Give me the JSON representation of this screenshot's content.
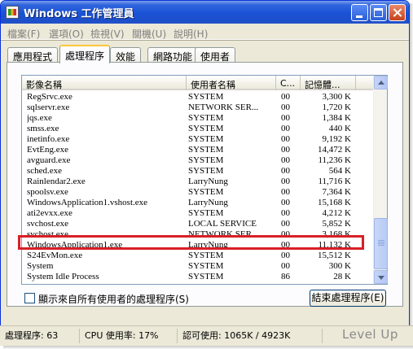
{
  "window": {
    "title": "Windows 工作管理員"
  },
  "menu": [
    "檔案(F)",
    "選項(O)",
    "檢視(V)",
    "關機(U)",
    "說明(H)"
  ],
  "tabs": [
    {
      "label": "應用程式",
      "active": false
    },
    {
      "label": "處理程序",
      "active": true
    },
    {
      "label": "效能",
      "active": false
    },
    {
      "label": "網路功能",
      "active": false
    },
    {
      "label": "使用者",
      "active": false
    }
  ],
  "table": {
    "columns": [
      "影像名稱",
      "使用者名稱",
      "C...",
      "記憶體..."
    ],
    "rows": [
      {
        "name": "RegSrvc.exe",
        "user": "SYSTEM",
        "cpu": "00",
        "mem": "3,300 K"
      },
      {
        "name": "sqlservr.exe",
        "user": "NETWORK SER...",
        "cpu": "00",
        "mem": "1,720 K"
      },
      {
        "name": "jqs.exe",
        "user": "SYSTEM",
        "cpu": "00",
        "mem": "1,384 K"
      },
      {
        "name": "smss.exe",
        "user": "SYSTEM",
        "cpu": "00",
        "mem": "440 K"
      },
      {
        "name": "inetinfo.exe",
        "user": "SYSTEM",
        "cpu": "00",
        "mem": "9,192 K"
      },
      {
        "name": "EvtEng.exe",
        "user": "SYSTEM",
        "cpu": "00",
        "mem": "14,472 K"
      },
      {
        "name": "avguard.exe",
        "user": "SYSTEM",
        "cpu": "00",
        "mem": "11,236 K"
      },
      {
        "name": "sched.exe",
        "user": "SYSTEM",
        "cpu": "00",
        "mem": "564 K"
      },
      {
        "name": "Rainlendar2.exe",
        "user": "LarryNung",
        "cpu": "00",
        "mem": "11,716 K"
      },
      {
        "name": "spoolsv.exe",
        "user": "SYSTEM",
        "cpu": "00",
        "mem": "7,364 K"
      },
      {
        "name": "WindowsApplication1.vshost.exe",
        "user": "LarryNung",
        "cpu": "00",
        "mem": "15,168 K"
      },
      {
        "name": "ati2evxx.exe",
        "user": "SYSTEM",
        "cpu": "00",
        "mem": "4,212 K"
      },
      {
        "name": "svchost.exe",
        "user": "LOCAL SERVICE",
        "cpu": "00",
        "mem": "5,852 K"
      },
      {
        "name": "svchost.exe",
        "user": "NETWORK SER...",
        "cpu": "00",
        "mem": "3,168 K"
      },
      {
        "name": "WindowsApplication1.exe",
        "user": "LarryNung",
        "cpu": "00",
        "mem": "11,132 K"
      },
      {
        "name": "S24EvMon.exe",
        "user": "SYSTEM",
        "cpu": "00",
        "mem": "15,512 K"
      },
      {
        "name": "System",
        "user": "SYSTEM",
        "cpu": "00",
        "mem": "300 K"
      },
      {
        "name": "System Idle Process",
        "user": "SYSTEM",
        "cpu": "86",
        "mem": "28 K"
      }
    ]
  },
  "show_all_users_label": "顯示來自所有使用者的處理程序(S)",
  "end_process_label": "結束處理程序(E)",
  "status": {
    "processes": "處理程序: 63",
    "cpu": "CPU 使用率: 17%",
    "commit": "認可使用: 1065K / 4923K"
  },
  "watermark": "Level Up",
  "colors": {
    "titlebar": "#1a52d6",
    "highlight": "#d81f26",
    "active_tab_accent": "#ffc83c"
  }
}
